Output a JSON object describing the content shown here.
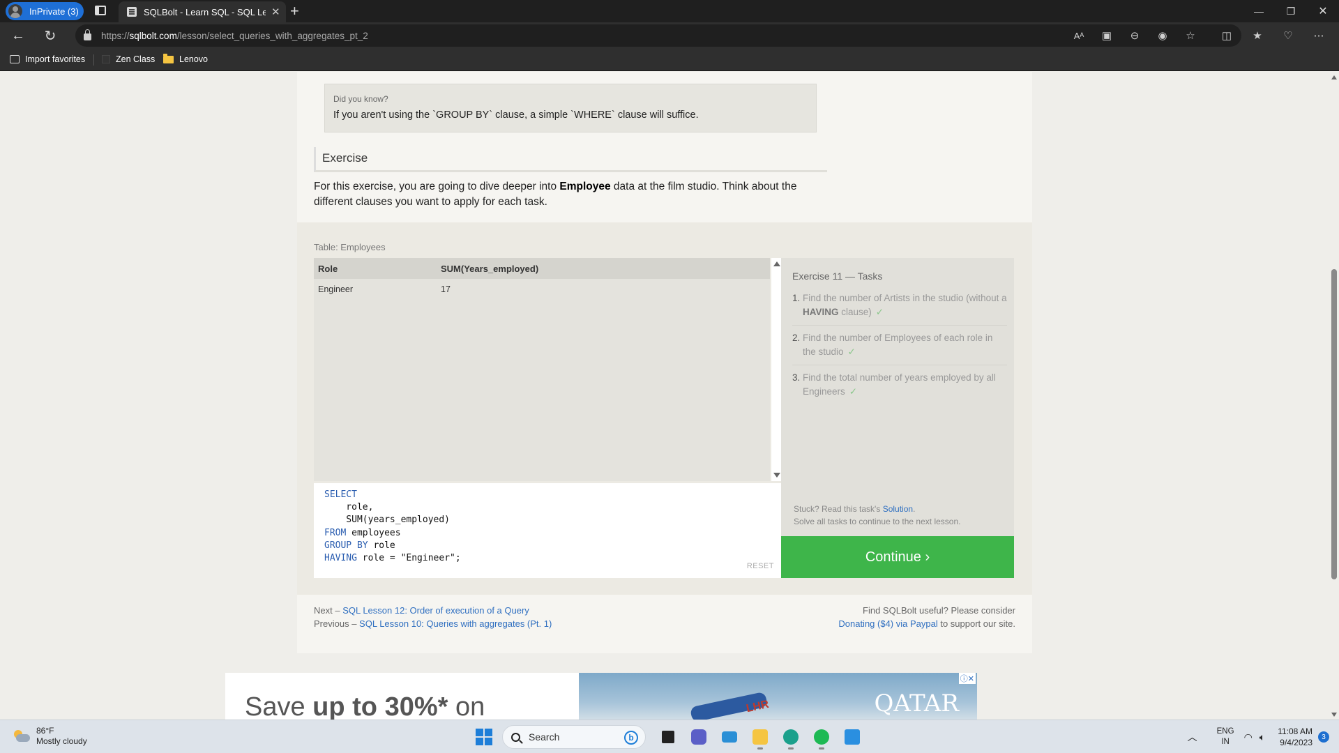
{
  "browser": {
    "profile_label": "InPrivate (3)",
    "tab_title": "SQLBolt - Learn SQL - SQL Lesson",
    "new_tab_symbol": "+",
    "url_prefix": "https://",
    "url_domain": "sqlbolt.com",
    "url_path": "/lesson/select_queries_with_aggregates_pt_2",
    "read_aloud_label": "Aᴬ",
    "favorites": [
      {
        "label": "Import favorites",
        "icon": "import-icon"
      },
      {
        "label": "Zen Class",
        "icon": "page-icon"
      },
      {
        "label": "Lenovo",
        "icon": "folder-icon"
      }
    ]
  },
  "page": {
    "did_you_know_title": "Did you know?",
    "did_you_know_text": "If you aren't using the `GROUP BY` clause, a simple `WHERE` clause will suffice.",
    "exercise_heading": "Exercise",
    "exercise_desc_before": "For this exercise, you are going to dive deeper into ",
    "exercise_desc_bold": "Employee",
    "exercise_desc_after": " data at the film studio. Think about the different clauses you want to apply for each task.",
    "table_label": "Table: Employees",
    "result_table": {
      "columns": [
        "Role",
        "SUM(Years_employed)"
      ],
      "rows": [
        [
          "Engineer",
          "17"
        ]
      ]
    },
    "query": {
      "line1_kw": "SELECT",
      "line2": "    role,",
      "line3": "    SUM(years_employed)",
      "line4_kw": "FROM",
      "line4_rest": " employees",
      "line5_kw": "GROUP BY",
      "line5_rest": " role",
      "line6_kw": "HAVING",
      "line6_rest": " role = \"Engineer\";"
    },
    "reset_label": "RESET",
    "tasks_title": "Exercise 11 — Tasks",
    "tasks": [
      {
        "num": "1.",
        "before": "Find the number of Artists in the studio (without a ",
        "bold": "HAVING",
        "after": " clause)",
        "check": "✓"
      },
      {
        "num": "2.",
        "before": "Find the number of Employees of each role in the studio",
        "bold": "",
        "after": "",
        "check": "✓"
      },
      {
        "num": "3.",
        "before": "Find the total number of years employed by all Engineers",
        "bold": "",
        "after": "",
        "check": "✓"
      }
    ],
    "stuck_before": "Stuck? Read this task's ",
    "stuck_link": "Solution",
    "stuck_after": ".",
    "solve_all": "Solve all tasks to continue to the next lesson.",
    "continue_label": "Continue ›",
    "next_prefix": "Next – ",
    "next_link": "SQL Lesson 12: Order of execution of a Query",
    "prev_prefix": "Previous – ",
    "prev_link": "SQL Lesson 10: Queries with aggregates (Pt. 1)",
    "donate_line1": "Find SQLBolt useful? Please consider",
    "donate_link": "Donating ($4) via Paypal",
    "donate_after": " to support our site."
  },
  "ad": {
    "text_before": "Save ",
    "text_bold": "up to 30%*",
    "text_after": " on",
    "image_sign": "LHR",
    "brand": "QATAR",
    "choices_label": "ⓘ✕"
  },
  "taskbar": {
    "temperature": "86°F",
    "condition": "Mostly cloudy",
    "search_placeholder": "Search",
    "bing_label": "b",
    "lang_line1": "ENG",
    "lang_line2": "IN",
    "time": "11:08 AM",
    "date": "9/4/2023",
    "notification_count": "3"
  },
  "colors": {
    "continue_green": "#3eb54a",
    "link_blue": "#2f6fc0",
    "sql_keyword": "#2a5db0",
    "inprivate_blue": "#1e6fd6"
  }
}
